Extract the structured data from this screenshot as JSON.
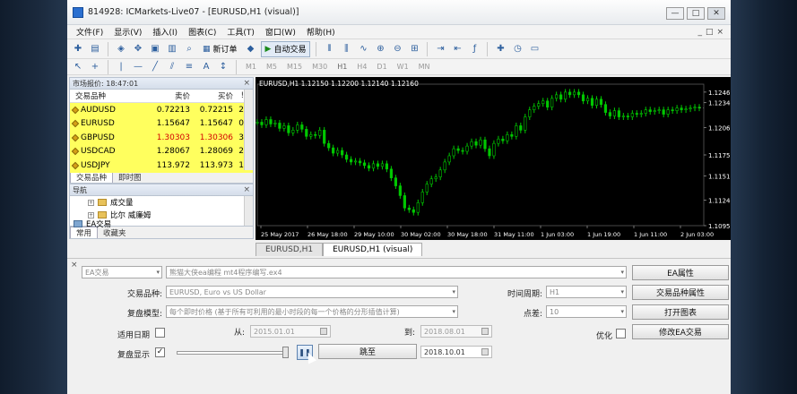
{
  "window": {
    "title": "814928: ICMarkets-Live07 - [EURUSD,H1 (visual)]"
  },
  "menu": {
    "items": [
      "文件(F)",
      "显示(V)",
      "插入(I)",
      "图表(C)",
      "工具(T)",
      "窗口(W)",
      "帮助(H)"
    ],
    "right": [
      "_",
      "□",
      "×"
    ]
  },
  "toolbar": {
    "new_order": "新订单",
    "auto_trading": "自动交易"
  },
  "toolbar2": {
    "timeframes": [
      "M1",
      "M5",
      "M15",
      "M30",
      "H1",
      "H4",
      "D1",
      "W1",
      "MN"
    ]
  },
  "market_watch": {
    "title": "市场报价: 18:47:01",
    "columns": [
      "交易品种",
      "卖价",
      "买价",
      "!"
    ],
    "rows": [
      {
        "symbol": "AUDUSD",
        "bid": "0.72213",
        "ask": "0.72215",
        "spread": "2",
        "red": false
      },
      {
        "symbol": "EURUSD",
        "bid": "1.15647",
        "ask": "1.15647",
        "spread": "0",
        "red": false
      },
      {
        "symbol": "GBPUSD",
        "bid": "1.30303",
        "ask": "1.30306",
        "spread": "3",
        "red": true
      },
      {
        "symbol": "USDCAD",
        "bid": "1.28067",
        "ask": "1.28069",
        "spread": "2",
        "red": false
      },
      {
        "symbol": "USDJPY",
        "bid": "113.972",
        "ask": "113.973",
        "spread": "1",
        "red": false
      }
    ],
    "tabs": [
      "交易品种",
      "即时图"
    ]
  },
  "navigator": {
    "title": "导航",
    "items": [
      "成交量",
      "比尔 威廉姆"
    ],
    "partial": "EA交易",
    "tabs": [
      "常用",
      "收藏夹"
    ]
  },
  "chart": {
    "label": "EURUSD,H1  1.12150 1.12200 1.12140 1.12160",
    "tabs": [
      "EURUSD,H1",
      "EURUSD,H1 (visual)"
    ],
    "colors": {
      "bg": "#000000",
      "bull": "#00c800",
      "bear": "#00c800",
      "grid": "#5a5a5a"
    }
  },
  "chart_data": {
    "type": "line",
    "title": "EURUSD,H1",
    "x_ticks": [
      "25 May 2017",
      "26 May 18:00",
      "29 May 10:00",
      "30 May 02:00",
      "30 May 18:00",
      "31 May 11:00",
      "1 Jun 03:00",
      "1 Jun 19:00",
      "1 Jun 11:00",
      "2 Jun 03:00"
    ],
    "y_ticks": [
      "1.12460",
      "1.12340",
      "1.12060",
      "1.11750",
      "1.11510",
      "1.11240",
      "1.10950"
    ],
    "ylim": [
      1.1095,
      1.1255
    ],
    "x": [
      0,
      4,
      8,
      12,
      16,
      20,
      24,
      28,
      32,
      36,
      40,
      44,
      48,
      52,
      56,
      60,
      64,
      68,
      72,
      76,
      80,
      84,
      88,
      92,
      96,
      100,
      104,
      108,
      112,
      116,
      120,
      124,
      128,
      132,
      136,
      140,
      144,
      148,
      152,
      156,
      160,
      164,
      168,
      172,
      176,
      180,
      184,
      188,
      192,
      196,
      200,
      204,
      208,
      212,
      216,
      220,
      224,
      228,
      232,
      236,
      240,
      244,
      248,
      252,
      256,
      260,
      264,
      268,
      272,
      276,
      280,
      284,
      288,
      292,
      296,
      300,
      304,
      308,
      312,
      316,
      320,
      324,
      328,
      332,
      336,
      340,
      344,
      348,
      352,
      356,
      360,
      364,
      368,
      372,
      376,
      380,
      384,
      388,
      392,
      396
    ],
    "values": [
      1.1212,
      1.1209,
      1.1215,
      1.121,
      1.1211,
      1.1205,
      1.1208,
      1.12,
      1.1203,
      1.1209,
      1.1204,
      1.1196,
      1.1198,
      1.1197,
      1.1203,
      1.1188,
      1.1183,
      1.1177,
      1.118,
      1.1175,
      1.117,
      1.1167,
      1.1168,
      1.1166,
      1.1163,
      1.116,
      1.1165,
      1.1162,
      1.1165,
      1.1159,
      1.1149,
      1.114,
      1.1129,
      1.1115,
      1.1113,
      1.111,
      1.1121,
      1.1133,
      1.1142,
      1.1148,
      1.115,
      1.1158,
      1.1167,
      1.1174,
      1.1182,
      1.118,
      1.1179,
      1.1185,
      1.119,
      1.1186,
      1.1192,
      1.1182,
      1.1174,
      1.1188,
      1.1193,
      1.1191,
      1.1198,
      1.1196,
      1.1208,
      1.1203,
      1.1218,
      1.1226,
      1.123,
      1.1233,
      1.1236,
      1.1229,
      1.1239,
      1.1243,
      1.1238,
      1.1246,
      1.1243,
      1.1246,
      1.1243,
      1.1236,
      1.1239,
      1.1231,
      1.1238,
      1.1232,
      1.1223,
      1.1219,
      1.1225,
      1.1218,
      1.1219,
      1.1218,
      1.1222,
      1.1221,
      1.1222,
      1.1226,
      1.1224,
      1.1225,
      1.1226,
      1.1221,
      1.1226,
      1.1225,
      1.1228,
      1.1226,
      1.1227,
      1.1228,
      1.1229,
      1.1228
    ]
  },
  "tester": {
    "expert_type": "EA交易",
    "expert_file": "熊猫大侠ea编程 mt4程序编写.ex4",
    "expert_props": "EA属性",
    "symbol_label": "交易品种:",
    "symbol_value": "EURUSD, Euro vs US Dollar",
    "period_label": "时间周期:",
    "period_value": "H1",
    "symbol_props": "交易品种属性",
    "model_label": "复盘模型:",
    "model_value": "每个即时价格 (基于所有可利用的最小时段的每一个价格的分形插值计算)",
    "spread_label": "点差:",
    "spread_value": "10",
    "open_chart": "打开图表",
    "use_date": "适用日期",
    "from_label": "从:",
    "from_value": "2015.01.01",
    "to_label": "到:",
    "to_value": "2018.08.01",
    "optimize": "优化",
    "modify_expert": "修改EA交易",
    "visual_label": "复盘显示",
    "skip_to": "跳至",
    "skip_date": "2018.10.01",
    "check": "✓"
  }
}
